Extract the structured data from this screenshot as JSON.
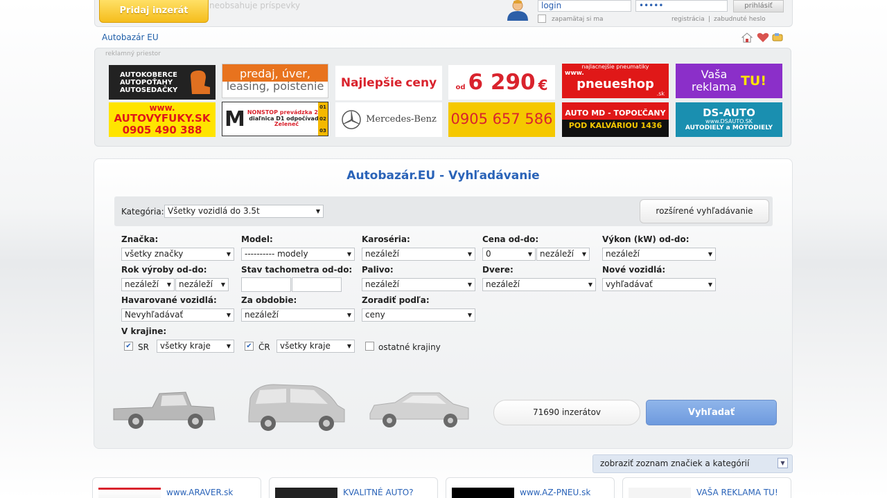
{
  "header": {
    "add_listing": "Pridaj inzerát",
    "faded_text": "neobsahuje príspevky",
    "login_value": "login",
    "password_value": "•••••",
    "login_button": "prihlásiť",
    "remember_me": "zapamätaj si ma",
    "register": "registrácia",
    "forgot_password": "zabudnuté heslo",
    "separator": "|"
  },
  "breadcrumb": {
    "brand": "Autobazár EU"
  },
  "ads": {
    "label": "reklamný priestor",
    "items": [
      {
        "lines": [
          "AUTOKOBERCE",
          "AUTOPOŤAHY",
          "AUTOSEDAČKY"
        ]
      },
      {
        "lines": [
          "predaj, úver,",
          "leasing, poistenie"
        ]
      },
      {
        "lines": [
          "Najlepšie",
          "ceny"
        ]
      },
      {
        "lines": [
          "od",
          "6 290",
          "€"
        ]
      },
      {
        "lines": [
          "najlacnejšie pneumatiky",
          "www.",
          "pneueshop",
          ".sk"
        ]
      },
      {
        "lines": [
          "Vaša",
          "reklama",
          "TU!"
        ]
      },
      {
        "lines": [
          "www.",
          "AUTOVYFUKY.SK",
          "0905 490 388"
        ]
      },
      {
        "lines": [
          "M",
          "NONSTOP prevádzka 24h",
          "diaľnica D1 odpočívadlo",
          "Zeleneč",
          "01",
          "02",
          "03"
        ]
      },
      {
        "lines": [
          "Mercedes-Benz"
        ]
      },
      {
        "lines": [
          "0905 657 586"
        ]
      },
      {
        "lines": [
          "AUTO MD - TOPOĽČANY",
          "POD KALVÁRIOU 1436"
        ]
      },
      {
        "lines": [
          "DS-AUTO",
          "www.DSAUTO.SK",
          "AUTODIELY a MOTODIELY"
        ]
      }
    ]
  },
  "search": {
    "title": "Autobazár.EU - Vyhľadávanie",
    "category_label": "Kategória:",
    "category_value": "Všetky vozidlá do 3.5t",
    "advanced_button": "rozšírené vyhľadávanie",
    "fields": {
      "brand": {
        "label": "Značka:",
        "value": "všetky značky"
      },
      "model": {
        "label": "Model:",
        "value": "---------- modely"
      },
      "body": {
        "label": "Karoséria:",
        "value": "nezáleží"
      },
      "price": {
        "label": "Cena od-do:",
        "from": "0",
        "to": "nezáleží"
      },
      "power": {
        "label": "Výkon (kW) od-do:",
        "value": "nezáleží"
      },
      "year": {
        "label": "Rok výroby od-do:",
        "from": "nezáleží",
        "to": "nezáleží"
      },
      "mileage": {
        "label": "Stav tachometra od-do:"
      },
      "fuel": {
        "label": "Palivo:",
        "value": "nezáleží"
      },
      "doors": {
        "label": "Dvere:",
        "value": "nezáleží"
      },
      "new": {
        "label": "Nové vozidlá:",
        "value": "vyhľadávať"
      },
      "crashed": {
        "label": "Havarované vozidlá:",
        "value": "Nevyhľadávať"
      },
      "period": {
        "label": "Za obdobie:",
        "value": "nezáleží"
      },
      "sort": {
        "label": "Zoradiť podľa:",
        "value": "ceny"
      }
    },
    "region": {
      "label": "V krajine:",
      "sr": {
        "label": "SR",
        "value": "všetky kraje",
        "checked": true
      },
      "cr": {
        "label": "ČR",
        "value": "všetky kraje",
        "checked": true
      },
      "other": {
        "label": "ostatné krajiny",
        "checked": false
      }
    },
    "count": "71690 inzerátov",
    "search_button": "Vyhľadať"
  },
  "brands_bar": {
    "label": "zobraziť zoznam značiek a kategórií"
  },
  "cards": [
    {
      "link": "www.ARAVER.sk"
    },
    {
      "link": "KVALITNÉ AUTO?"
    },
    {
      "link": "www.AZ-PNEU.sk"
    },
    {
      "link": "VAŠA REKLAMA TU!"
    }
  ]
}
